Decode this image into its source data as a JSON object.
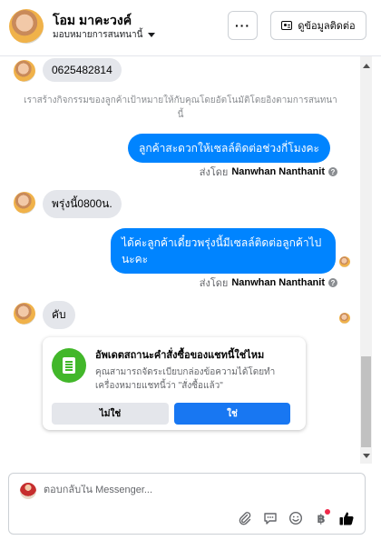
{
  "header": {
    "contact_name": "โอม มาคะวงค์",
    "assign_label": "มอบหมายการสนทนานี้",
    "more_label": "···",
    "info_button_label": "ดูข้อมูลติดต่อ"
  },
  "messages": {
    "m1_text": "0625482814",
    "system_note": "เราสร้างกิจกรรมของลูกค้าเป้าหมายให้กับคุณโดยอัตโนมัติโดยอิงตามการสนทนานี้",
    "m2_text": "ลูกค้าสะดวกให้เซลล์ติดต่อช่วงกี่โมงคะ",
    "sent_by_prefix_1": "ส่งโดย",
    "sender_name_1": "Nanwhan Nanthanit",
    "m3_text": "พรุ่งนี้0800น.",
    "m4_text": "ได้ค่ะลูกค้าเดี๋ยวพรุ่งนี้มีเซลล์ติดต่อลูกค้าไปนะคะ",
    "sent_by_prefix_2": "ส่งโดย",
    "sender_name_2": "Nanwhan Nanthanit",
    "m5_text": "คับ",
    "help_icon_glyph": "?"
  },
  "prompt": {
    "title": "อัพเดตสถานะคำสั่งซื้อของแชทนี้ใช่ไหม",
    "body": "คุณสามารถจัดระเบียบกล่องข้อความได้โดยทำเครื่องหมายแชทนี้ว่า \"สั่งซื้อแล้ว\"",
    "no_label": "ไม่ใช่",
    "yes_label": "ใช่"
  },
  "composer": {
    "placeholder": "ตอบกลับใน Messenger..."
  },
  "icons": {
    "more": "ellipsis-icon",
    "info": "contact-card-icon",
    "attach": "paperclip-icon",
    "saved_replies": "chat-bubble-icon",
    "emoji": "emoji-icon",
    "payment": "baht-icon",
    "like": "thumbs-up-icon"
  },
  "colors": {
    "outgoing_bubble": "#0084ff",
    "incoming_bubble": "#e4e6eb",
    "primary_button": "#1877f2",
    "prompt_icon_bg": "#42b72a"
  }
}
